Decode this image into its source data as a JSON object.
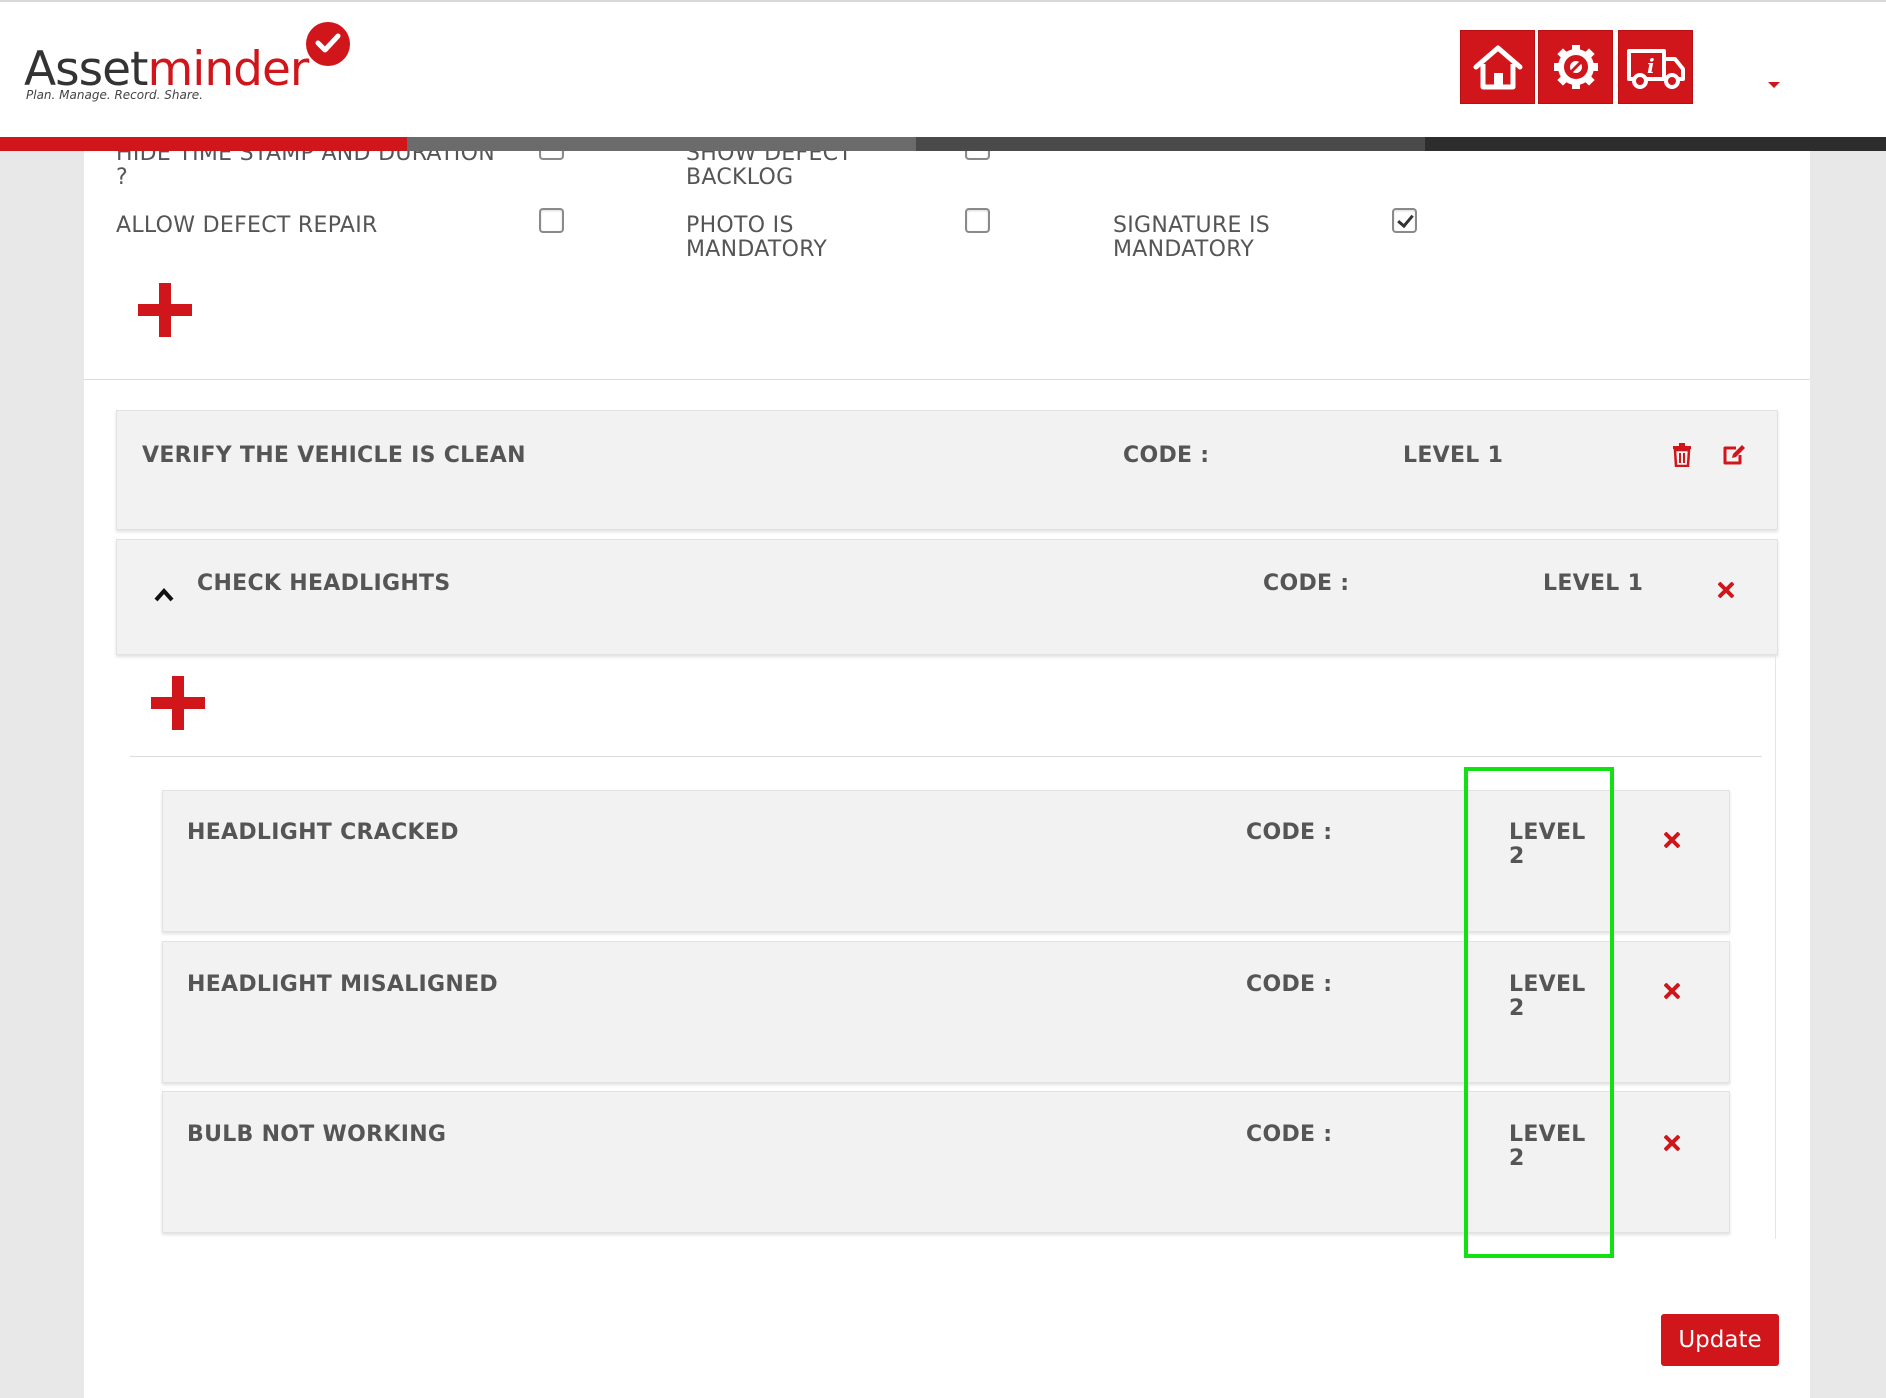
{
  "brand": {
    "name_part1": "Asset",
    "name_part2": "minder",
    "tagline": "Plan. Manage. Record. Share."
  },
  "nav_icons": [
    "home-icon",
    "settings-icon",
    "vehicle-info-icon"
  ],
  "colors": {
    "accent": "#d0151b",
    "highlight": "#12e012",
    "row_bg": "#f2f2f2"
  },
  "options": {
    "hide_timestamp": {
      "label_line1": "HIDE TIME STAMP AND DURATION",
      "label_line2": "?",
      "checked": false
    },
    "show_defect_backlog": {
      "label_line1": "SHOW DEFECT",
      "label_line2": "BACKLOG",
      "checked": false
    },
    "allow_defect_repair": {
      "label": "ALLOW DEFECT REPAIR",
      "checked": false
    },
    "photo_mandatory": {
      "label_line1": "PHOTO IS",
      "label_line2": "MANDATORY",
      "checked": false
    },
    "signature_mandatory": {
      "label_line1": "SIGNATURE IS",
      "label_line2": "MANDATORY",
      "checked": true
    }
  },
  "items": [
    {
      "title": "VERIFY THE VEHICLE IS CLEAN",
      "code_label": "CODE :",
      "level": "LEVEL 1"
    },
    {
      "title": "CHECK HEADLIGHTS",
      "code_label": "CODE :",
      "level": "LEVEL 1",
      "expanded": true
    }
  ],
  "sub_items": [
    {
      "title": "HEADLIGHT CRACKED",
      "code_label": "CODE :",
      "level_line1": "LEVEL",
      "level_line2": "2"
    },
    {
      "title": "HEADLIGHT MISALIGNED",
      "code_label": "CODE :",
      "level_line1": "LEVEL",
      "level_line2": "2"
    },
    {
      "title": "BULB NOT WORKING",
      "code_label": "CODE :",
      "level_line1": "LEVEL",
      "level_line2": "2"
    }
  ],
  "update_label": "Update"
}
